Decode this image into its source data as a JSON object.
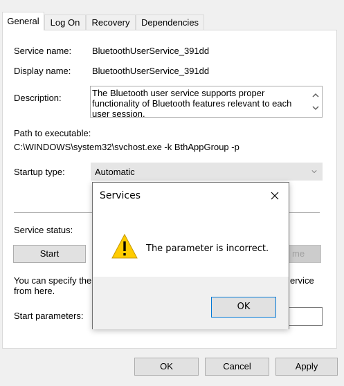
{
  "tabs": [
    "General",
    "Log On",
    "Recovery",
    "Dependencies"
  ],
  "fields": {
    "service_name_label": "Service name:",
    "service_name_value": "BluetoothUserService_391dd",
    "display_name_label": "Display name:",
    "display_name_value": "BluetoothUserService_391dd",
    "description_label": "Description:",
    "description_value": "The Bluetooth user service supports proper functionality of Bluetooth features relevant to each user session.",
    "path_label": "Path to executable:",
    "path_value": "C:\\WINDOWS\\system32\\svchost.exe -k BthAppGroup -p",
    "startup_type_label": "Startup type:",
    "startup_type_value": "Automatic",
    "service_status_label": "Service status:",
    "start_button": "Start",
    "resume_button_partial": "me",
    "hint_line1_left": "You can specify the",
    "hint_line1_right": "ervice",
    "hint_line2": "from here.",
    "start_params_label": "Start parameters:"
  },
  "footer": {
    "ok": "OK",
    "cancel": "Cancel",
    "apply": "Apply"
  },
  "dialog": {
    "title": "Services",
    "message": "The parameter is incorrect.",
    "ok": "OK"
  },
  "colors": {
    "accent": "#0078d7",
    "warning": "#ffcc00"
  }
}
